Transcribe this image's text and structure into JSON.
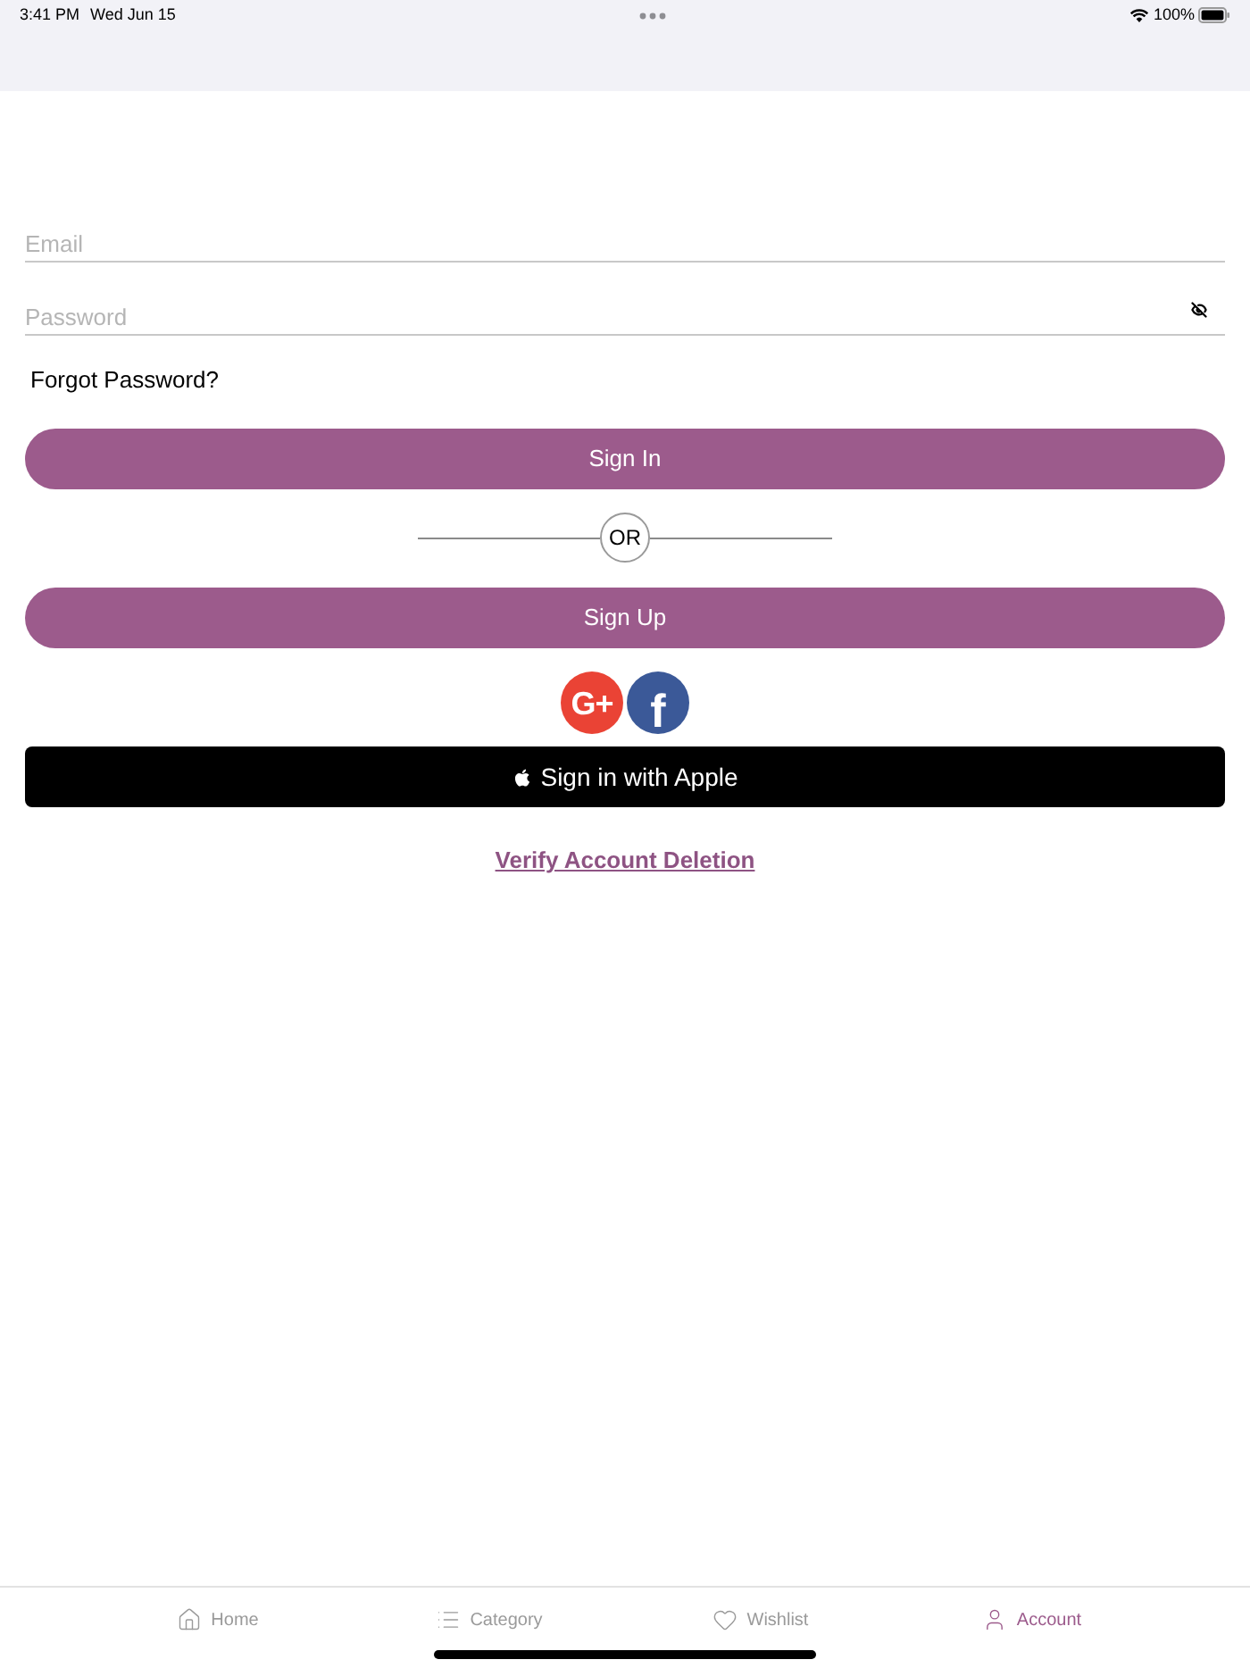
{
  "status_bar": {
    "time": "3:41 PM",
    "date": "Wed Jun 15",
    "battery": "100%"
  },
  "form": {
    "email": {
      "placeholder": "Email"
    },
    "password": {
      "placeholder": "Password"
    },
    "forgot_link": "Forgot Password?",
    "sign_in_button": "Sign In",
    "divider": "OR",
    "sign_up_button": "Sign Up"
  },
  "social_buttons": [
    {
      "kind": "google",
      "label": "G+"
    },
    {
      "kind": "facebook",
      "label": "f"
    }
  ],
  "apple_button": "Sign in with Apple",
  "delete_link": "Verify Account Deletion",
  "tab_bar": [
    {
      "label": "Home",
      "selected": false
    },
    {
      "label": "Category",
      "selected": false
    },
    {
      "label": "Wishlist",
      "selected": false
    },
    {
      "label": "Account",
      "selected": true
    }
  ]
}
